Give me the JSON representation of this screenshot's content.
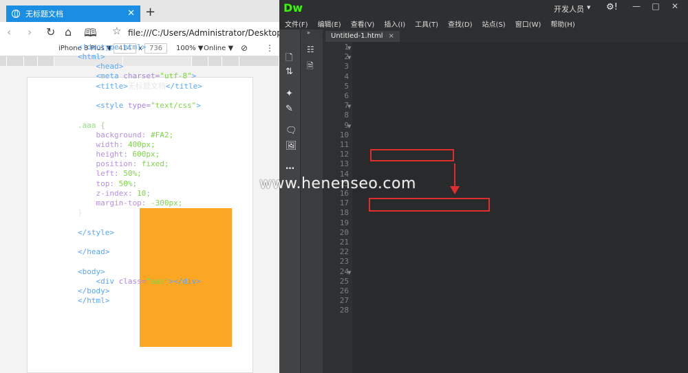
{
  "browser": {
    "tab_title": "无标题文档",
    "tab_close": "✕",
    "new_tab": "+",
    "url": "file:///C:/Users/Administrator/Desktop/新建",
    "device": "iPhone 8 Plus",
    "width": "414",
    "height": "736",
    "times": "x",
    "zoom": "100%",
    "network": "Online"
  },
  "dw": {
    "logo": "Dw",
    "workspace": "开发人员",
    "menu": [
      "文件(F)",
      "编辑(E)",
      "查看(V)",
      "插入(I)",
      "工具(T)",
      "查找(D)",
      "站点(S)",
      "窗口(W)",
      "帮助(H)"
    ],
    "doc_tab": "Untitled-1.html",
    "doc_tab_close": "×",
    "line_numbers": [
      "1",
      "2",
      "3",
      "4",
      "5",
      "6",
      "7",
      "8",
      "9",
      "10",
      "11",
      "12",
      "13",
      "14",
      "15",
      "16",
      "17",
      "18",
      "19",
      "20",
      "21",
      "22",
      "23",
      "24",
      "25",
      "26",
      "27",
      "28"
    ]
  },
  "code": {
    "l1": "<!doctype html>",
    "l2a": "<html>",
    "l3": "<head>",
    "l4_tag": "<meta",
    "l4_attr": " charset=",
    "l4_str": "\"utf-8\"",
    "l4_end": ">",
    "l5_open": "<title>",
    "l5_text": "无标题文档",
    "l5_close": "</title>",
    "l7_tag": "<style",
    "l7_attr": " type=",
    "l7_str": "\"text/css\"",
    "l7_end": ">",
    "l9": ".aaa {",
    "p10": "background:",
    "v10": " #FA2;",
    "p11": "width:",
    "v11": " 400px;",
    "p12": "height:",
    "v12": " 600px;",
    "p13": "position:",
    "v13": " fixed;",
    "p14": "left:",
    "v14": " 50%;",
    "p15": "top:",
    "v15": " 50%;",
    "p16": "z-index:",
    "v16": " 10;",
    "p17": "margin-top:",
    "v17": " -300px;",
    "l18": "}",
    "l20": "</style>",
    "l22": "</head>",
    "l24": "<body>",
    "l25_tag": "<div",
    "l25_attr": " class=",
    "l25_str": "\"aaa\"",
    "l25_end": "></div>",
    "l26": "</body>",
    "l27": "</html>"
  },
  "watermark": "www.henenseo.com",
  "colors": {
    "orange_box": "#fba723",
    "highlight_red": "#e02d2d",
    "tab_blue": "#1a8ee3",
    "dw_green": "#35fa00"
  }
}
